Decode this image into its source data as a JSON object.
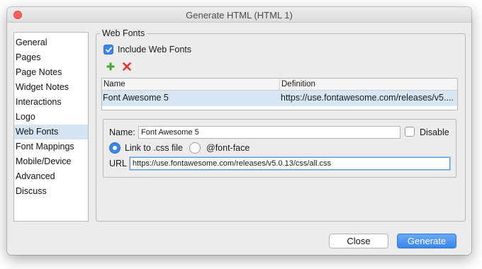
{
  "window": {
    "title": "Generate HTML (HTML 1)"
  },
  "sidebar": {
    "items": [
      {
        "label": "General"
      },
      {
        "label": "Pages"
      },
      {
        "label": "Page Notes"
      },
      {
        "label": "Widget Notes"
      },
      {
        "label": "Interactions"
      },
      {
        "label": "Logo"
      },
      {
        "label": "Web Fonts",
        "selected": true
      },
      {
        "label": "Font Mappings"
      },
      {
        "label": "Mobile/Device"
      },
      {
        "label": "Advanced"
      },
      {
        "label": "Discuss"
      }
    ]
  },
  "web_fonts": {
    "legend": "Web Fonts",
    "include_label": "Include Web Fonts",
    "include_checked": true,
    "toolbar": {
      "add_icon": "plus-icon",
      "remove_icon": "x-icon"
    },
    "table": {
      "columns": [
        "Name",
        "Definition"
      ],
      "rows": [
        {
          "name": "Font Awesome 5",
          "definition": "https://use.fontawesome.com/releases/v5...."
        }
      ]
    },
    "editor": {
      "name_label": "Name:",
      "name_value": "Font Awesome 5",
      "disable_label": "Disable",
      "disable_checked": false,
      "mode_options": [
        "Link to .css file",
        "@font-face"
      ],
      "mode_selected": "Link to .css file",
      "url_label": "URL",
      "url_value": "https://use.fontawesome.com/releases/v5.0.13/css/all.css"
    }
  },
  "buttons": {
    "close_label": "Close",
    "generate_label": "Generate"
  },
  "colors": {
    "accent": "#3b86e6",
    "selection": "#d5e4f1",
    "close_dot": "#fc605c",
    "add_green": "#4aa832",
    "remove_red": "#e2332b"
  }
}
